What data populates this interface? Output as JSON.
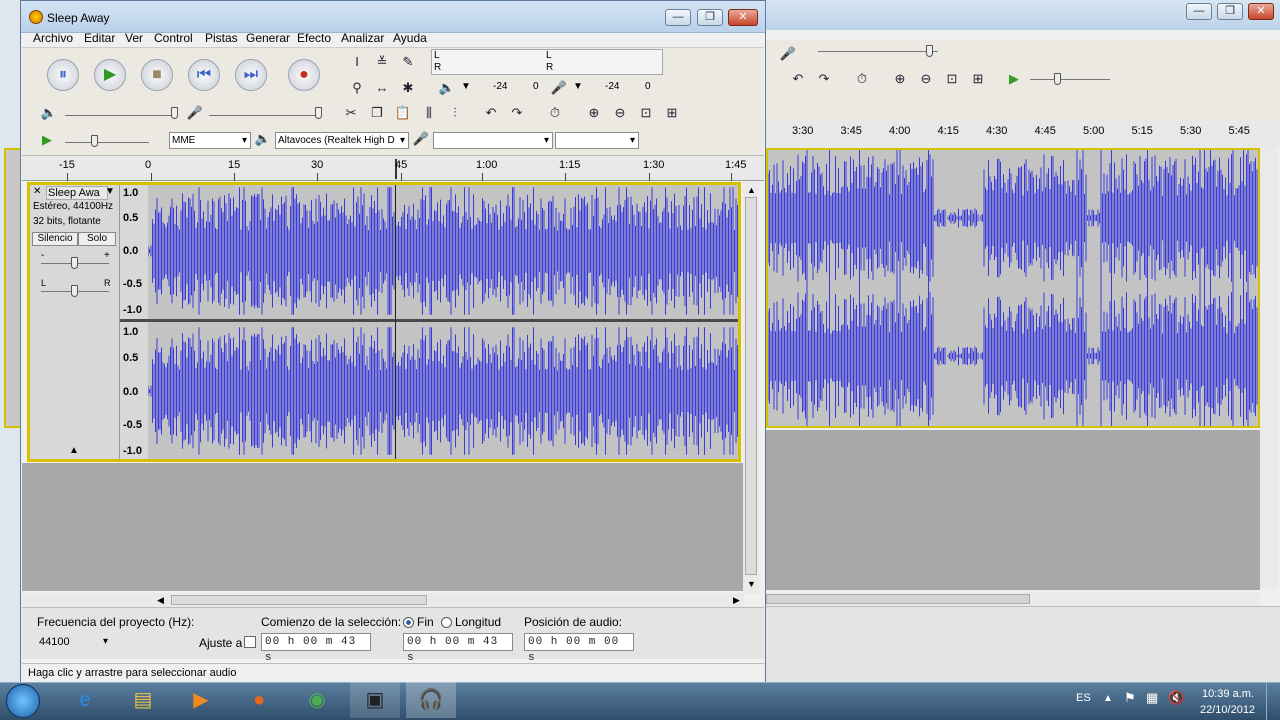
{
  "window": {
    "title": "Sleep Away",
    "minimize": "—",
    "maximize": "❐",
    "close": "✕"
  },
  "menu": [
    "Archivo",
    "Editar",
    "Ver",
    "Control",
    "Pistas",
    "Generar",
    "Efecto",
    "Analizar",
    "Ayuda"
  ],
  "meters": {
    "l": "L",
    "r": "R",
    "scale1": "-24",
    "zero1": "0",
    "scale2": "-24",
    "zero2": "0"
  },
  "device": {
    "host": "MME",
    "output": "Altavoces (Realtek High D",
    "input": "",
    "channels": ""
  },
  "ruler": {
    "ticks": [
      "-15",
      "0",
      "15",
      "30",
      "45",
      "1:00",
      "1:15",
      "1:30",
      "1:45"
    ],
    "ticks_right": [
      "3:30",
      "3:45",
      "4:00",
      "4:15",
      "4:30",
      "4:45",
      "5:00",
      "5:15",
      "5:30",
      "5:45"
    ]
  },
  "track": {
    "name": "Sleep Awa",
    "info1": "Estéreo, 44100Hz",
    "info2": "32 bits, flotante",
    "mute": "Silencio",
    "solo": "Solo",
    "gain_minus": "-",
    "gain_plus": "+",
    "pan_l": "L",
    "pan_r": "R",
    "y_labels_top": [
      "1.0",
      "0.5",
      "0.0",
      "-0.5",
      "-1.0"
    ],
    "y_labels_bottom": [
      "1.0",
      "0.5",
      "0.0",
      "-0.5",
      "-1.0"
    ],
    "wave_color": "#3b3bdc"
  },
  "selectionbar": {
    "rate_label": "Frecuencia del proyecto (Hz):",
    "rate_value": "44100",
    "snap_label": "Ajuste a",
    "start_label": "Comienzo de la selección:",
    "end_option": "Fin",
    "length_option": "Longitud",
    "position_label": "Posición de audio:",
    "start_value": "00 h 00 m 43 s",
    "end_value": "00 h 00 m 43 s",
    "position_value": "00 h 00 m 00 s"
  },
  "status": "Haga clic y arrastre para seleccionar audio",
  "taskbar": {
    "lang": "ES",
    "time": "10:39 a.m.",
    "date": "22/10/2012"
  }
}
